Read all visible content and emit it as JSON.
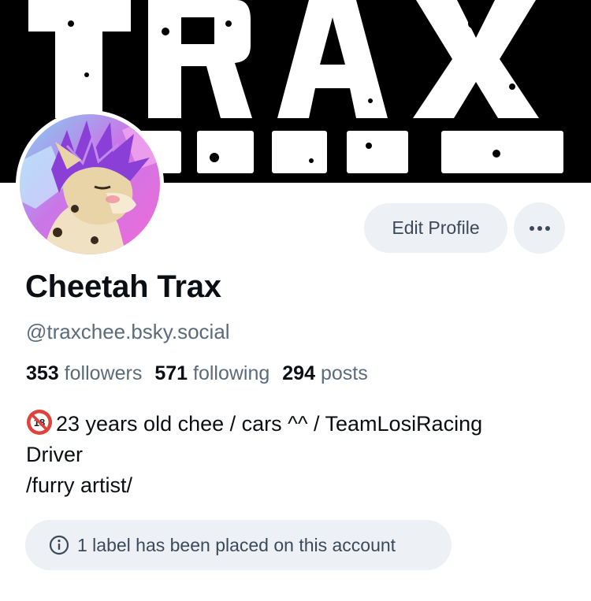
{
  "banner": {
    "text": "TRAX"
  },
  "profile": {
    "display_name": "Cheetah Trax",
    "handle": "@traxchee.bsky.social",
    "avatar_icon": "cheetah-avatar-illustration"
  },
  "actions": {
    "edit_profile_label": "Edit Profile",
    "more_icon": "ellipsis-icon"
  },
  "stats": {
    "followers_count": "353",
    "followers_label": "followers",
    "following_count": "571",
    "following_label": "following",
    "posts_count": "294",
    "posts_label": "posts"
  },
  "bio": {
    "age_icon": "no-under-18-icon",
    "line1": "23 years old chee / cars ^^ / TeamLosiRacing",
    "line2": "Driver",
    "line3": "/furry artist/"
  },
  "labels_notice": {
    "icon": "info-icon",
    "text": "1 label has been placed on this account"
  },
  "colors": {
    "pill_bg": "#edf0f4",
    "muted_text": "#5b6b7b",
    "button_text": "#3b4a5a",
    "banner_bg": "#000000",
    "banner_text": "#ffffff"
  }
}
